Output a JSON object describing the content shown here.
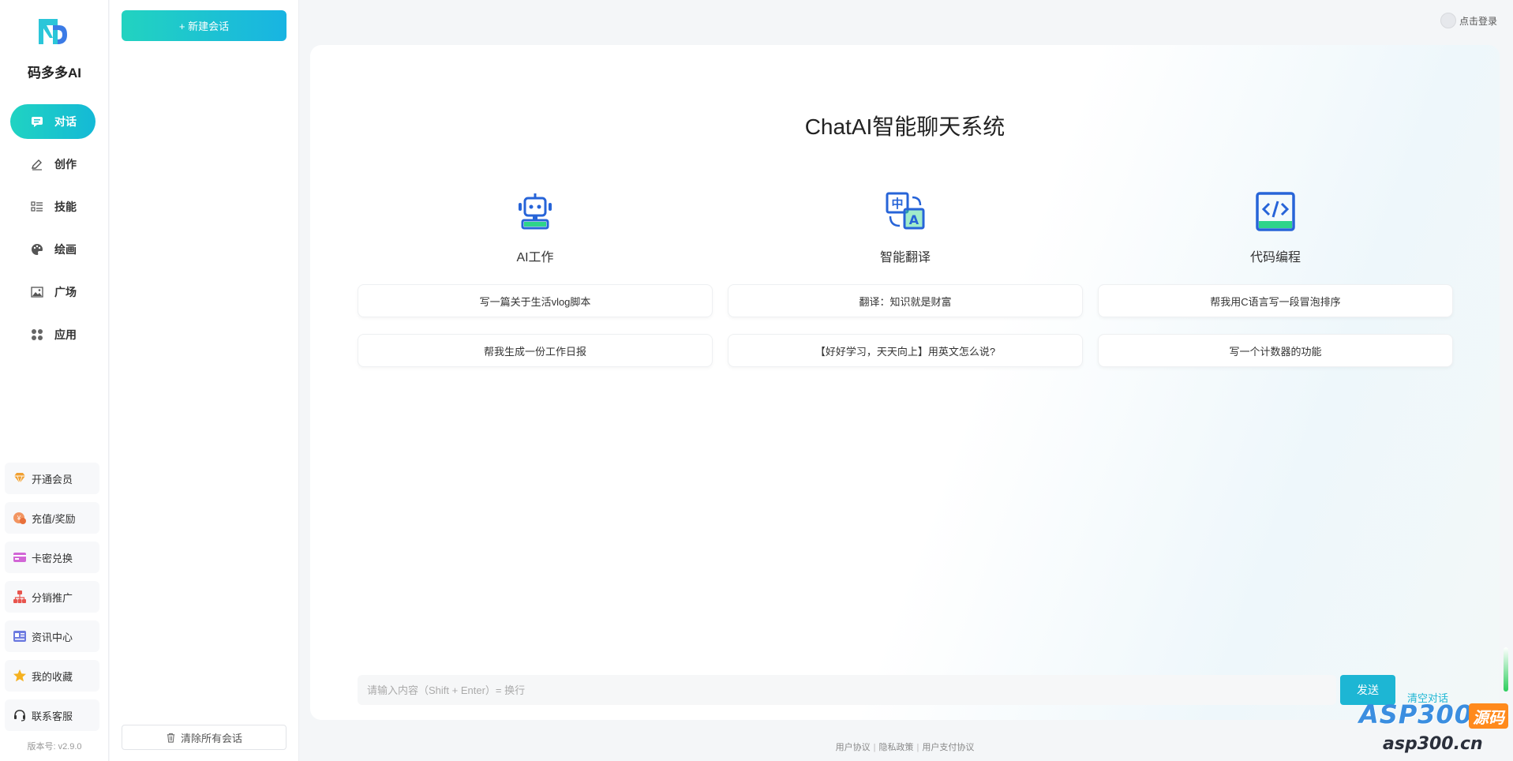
{
  "brand": {
    "name": "码多多AI"
  },
  "nav": [
    {
      "label": "对话",
      "icon": "chat-icon",
      "active": true
    },
    {
      "label": "创作",
      "icon": "pencil-icon"
    },
    {
      "label": "技能",
      "icon": "list-icon"
    },
    {
      "label": "绘画",
      "icon": "palette-icon"
    },
    {
      "label": "广场",
      "icon": "image-icon"
    },
    {
      "label": "应用",
      "icon": "apps-icon"
    }
  ],
  "bottom_menu": [
    {
      "label": "开通会员",
      "icon": "diamond-icon"
    },
    {
      "label": "充值/奖励",
      "icon": "coin-icon"
    },
    {
      "label": "卡密兑换",
      "icon": "card-icon"
    },
    {
      "label": "分销推广",
      "icon": "network-icon"
    },
    {
      "label": "资讯中心",
      "icon": "news-icon"
    },
    {
      "label": "我的收藏",
      "icon": "star-icon"
    },
    {
      "label": "联系客服",
      "icon": "headset-icon"
    }
  ],
  "version": "版本号: v2.9.0",
  "conversations": {
    "new_label": "+ 新建会话",
    "clear_label": "清除所有会话"
  },
  "header": {
    "login": "点击登录"
  },
  "main": {
    "title": "ChatAI智能聊天系统",
    "columns": [
      {
        "title": "AI工作",
        "icon": "robot-icon",
        "suggestions": [
          "写一篇关于生活vlog脚本",
          "帮我生成一份工作日报"
        ]
      },
      {
        "title": "智能翻译",
        "icon": "translate-icon",
        "suggestions": [
          "翻译：知识就是财富",
          "【好好学习，天天向上】用英文怎么说?"
        ]
      },
      {
        "title": "代码编程",
        "icon": "code-icon",
        "suggestions": [
          "帮我用C语言写一段冒泡排序",
          "写一个计数器的功能"
        ]
      }
    ],
    "input_placeholder": "请输入内容（Shift + Enter）= 换行",
    "send": "发送",
    "clear_chat": "清空对话"
  },
  "footer": {
    "links": [
      "用户协议",
      "隐私政策",
      "用户支付协议"
    ]
  },
  "watermark": {
    "text": "ASP300",
    "badge": "源码",
    "site": "asp300.cn"
  },
  "colors": {
    "accent": "#1db6d4",
    "accent_start": "#20d3c2",
    "icon_blue": "#2764d8",
    "icon_green": "#2ed48a"
  }
}
